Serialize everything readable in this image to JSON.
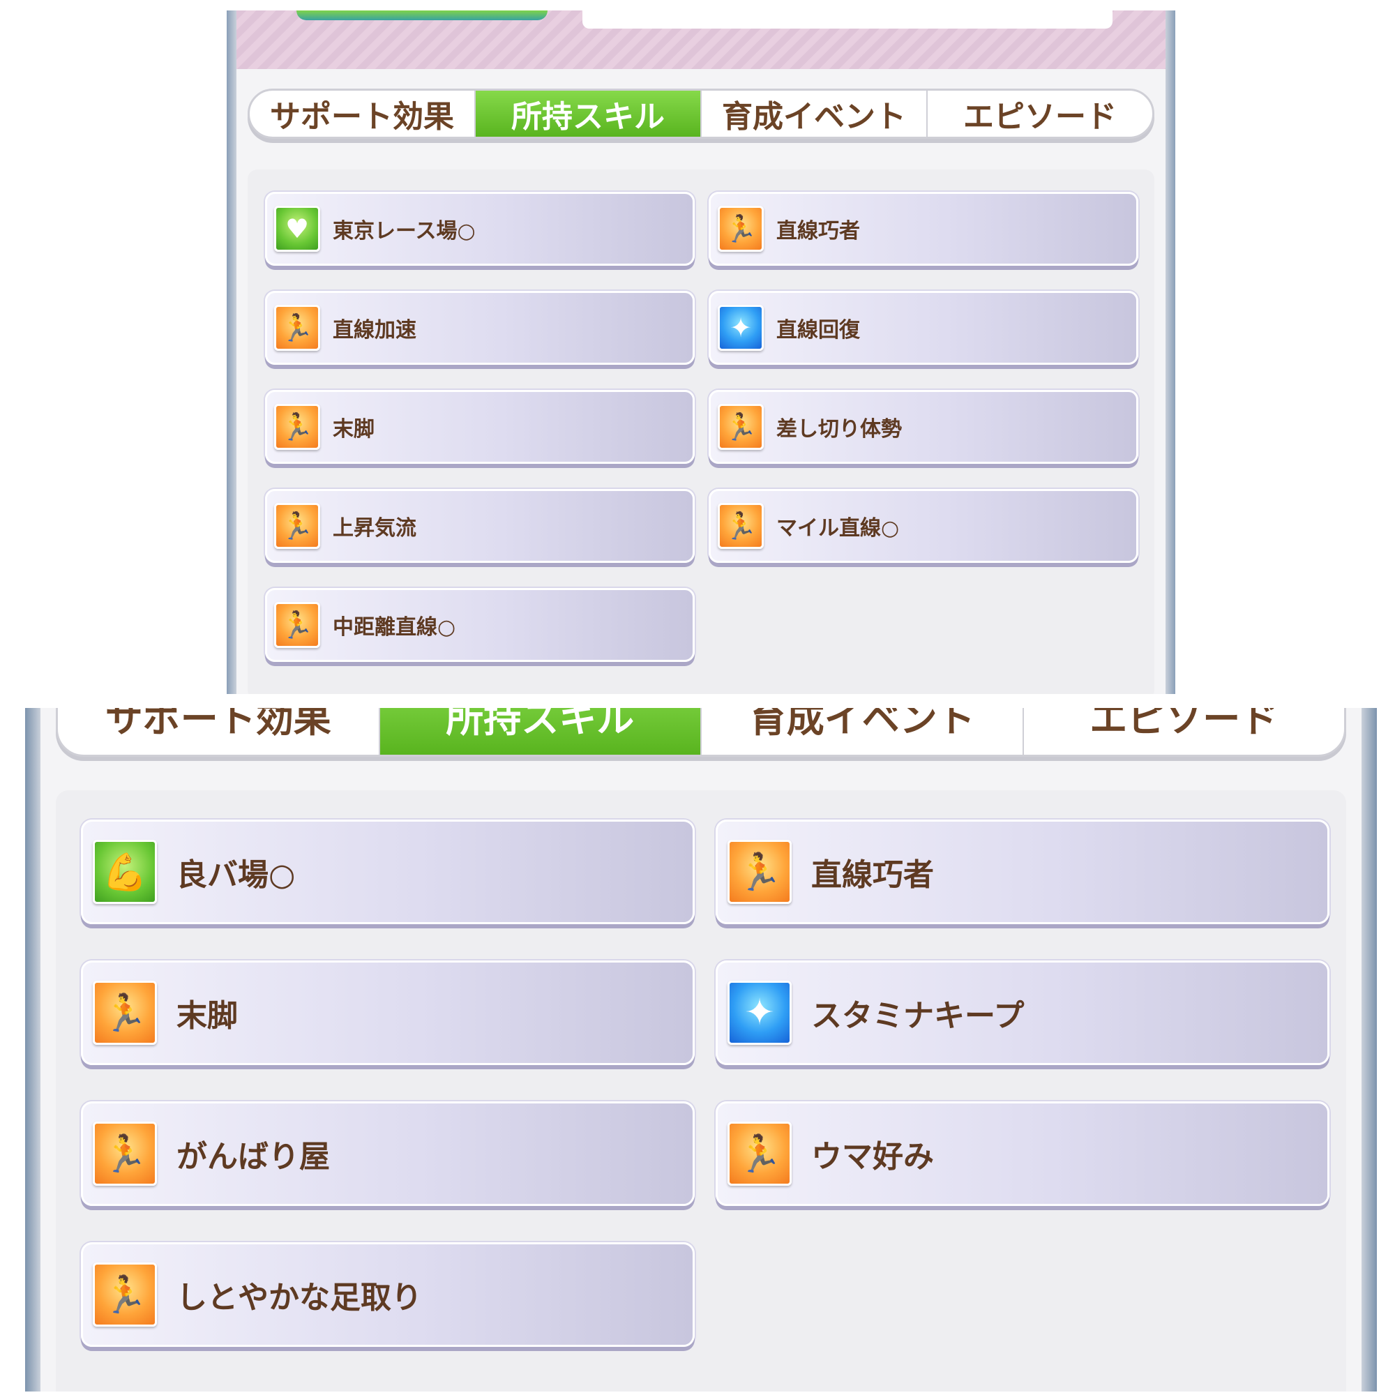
{
  "top_panel": {
    "tabs": [
      {
        "label": "サポート効果",
        "active": false
      },
      {
        "label": "所持スキル",
        "active": true
      },
      {
        "label": "育成イベント",
        "active": false
      },
      {
        "label": "エピソード",
        "active": false
      }
    ],
    "skills": [
      {
        "name": "東京レース場○",
        "icon": "heart-icon",
        "color": "green"
      },
      {
        "name": "直線巧者",
        "icon": "running-figure-icon",
        "color": "orange"
      },
      {
        "name": "直線加速",
        "icon": "running-figure-icon",
        "color": "orange"
      },
      {
        "name": "直線回復",
        "icon": "sparkle-icon",
        "color": "blue"
      },
      {
        "name": "末脚",
        "icon": "running-figure-icon",
        "color": "orange"
      },
      {
        "name": "差し切り体勢",
        "icon": "running-figure-icon",
        "color": "orange"
      },
      {
        "name": "上昇気流",
        "icon": "running-figure-icon",
        "color": "orange"
      },
      {
        "name": "マイル直線○",
        "icon": "running-figure-icon",
        "color": "orange"
      },
      {
        "name": "中距離直線○",
        "icon": "running-figure-icon",
        "color": "orange"
      }
    ]
  },
  "bottom_panel": {
    "tabs": [
      {
        "label": "サポート効果",
        "active": false
      },
      {
        "label": "所持スキル",
        "active": true
      },
      {
        "label": "育成イベント",
        "active": false
      },
      {
        "label": "エピソード",
        "active": false
      }
    ],
    "skills": [
      {
        "name": "良バ場○",
        "icon": "flexed-arm-icon",
        "color": "green"
      },
      {
        "name": "直線巧者",
        "icon": "running-figure-icon",
        "color": "orange"
      },
      {
        "name": "末脚",
        "icon": "running-figure-icon",
        "color": "orange"
      },
      {
        "name": "スタミナキープ",
        "icon": "sparkle-icon",
        "color": "blue"
      },
      {
        "name": "がんばり屋",
        "icon": "running-figure-icon",
        "color": "orange"
      },
      {
        "name": "ウマ好み",
        "icon": "running-figure-icon",
        "color": "orange"
      },
      {
        "name": "しとやかな足取り",
        "icon": "running-figure-icon",
        "color": "orange"
      }
    ]
  },
  "icon_glyphs": {
    "running-figure-icon": "🏃",
    "heart-icon": "♥",
    "sparkle-icon": "✦",
    "flexed-arm-icon": "💪"
  },
  "colors": {
    "active_tab": "#6cc52f",
    "label_text": "#5e3a22",
    "card_base": "#dedcf0"
  }
}
